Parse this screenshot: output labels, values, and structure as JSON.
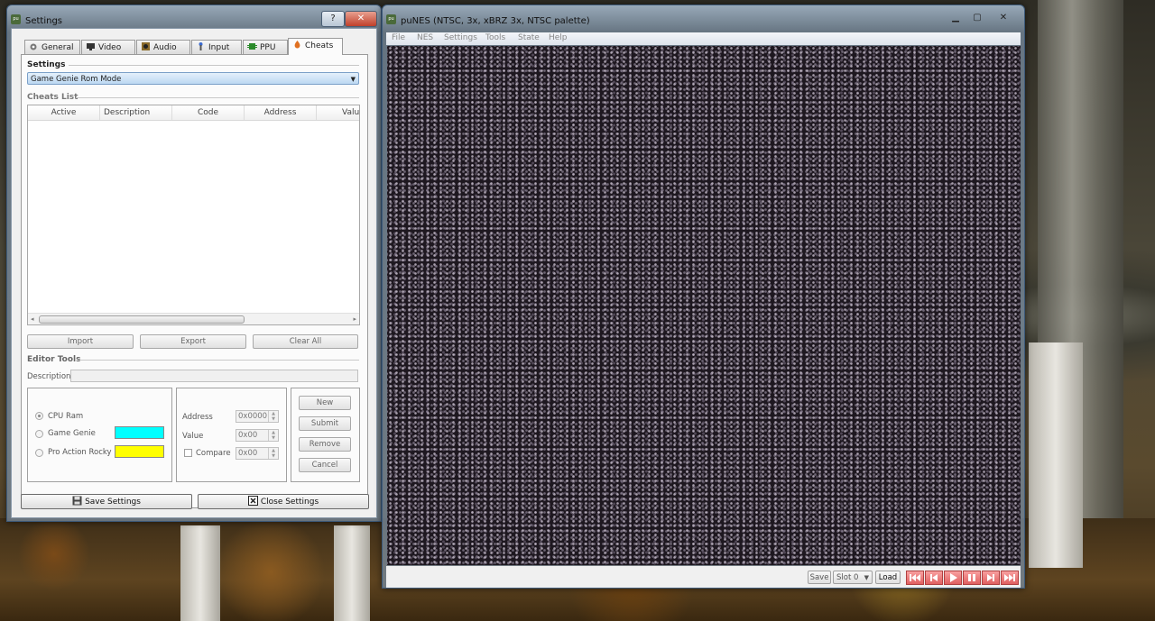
{
  "settings_window": {
    "title": "Settings",
    "help_btn": "?",
    "close_btn": "✕",
    "tabs": [
      {
        "label": "General",
        "icon": "gear-icon"
      },
      {
        "label": "Video",
        "icon": "monitor-icon"
      },
      {
        "label": "Audio",
        "icon": "speaker-icon"
      },
      {
        "label": "Input",
        "icon": "joystick-icon"
      },
      {
        "label": "PPU",
        "icon": "chip-icon"
      },
      {
        "label": "Cheats",
        "icon": "flame-icon"
      }
    ],
    "active_tab": "Cheats",
    "settings_section": "Settings",
    "mode_select": "Game Genie Rom Mode",
    "cheats_list_section": "Cheats List",
    "columns": [
      "Active",
      "Description",
      "Code",
      "Address",
      "Valu"
    ],
    "import_btn": "Import",
    "export_btn": "Export",
    "clear_all_btn": "Clear All",
    "editor_tools_section": "Editor Tools",
    "description_label": "Description",
    "radios": [
      {
        "label": "CPU Ram",
        "selected": true
      },
      {
        "label": "Game Genie",
        "selected": false,
        "swatch": "#00ffff"
      },
      {
        "label": "Pro Action Rocky",
        "selected": false,
        "swatch": "#ffff00"
      }
    ],
    "address_label": "Address",
    "address_value": "0x0000",
    "value_label": "Value",
    "value_value": "0x00",
    "compare_label": "Compare",
    "compare_value": "0x00",
    "new_btn": "New",
    "submit_btn": "Submit",
    "remove_btn": "Remove",
    "cancel_btn": "Cancel",
    "save_settings_btn": "Save Settings",
    "close_settings_btn": "Close Settings"
  },
  "punes_window": {
    "title": "puNES (NTSC, 3x, xBRZ 3x, NTSC palette)",
    "menu": [
      "File",
      "NES",
      "Settings",
      "Tools",
      "State",
      "Help"
    ],
    "save_btn": "Save",
    "slot_select": "Slot 0",
    "load_btn": "Load",
    "transport": [
      "rewind-fast-icon",
      "step-back-icon",
      "play-icon",
      "pause-icon",
      "step-forward-icon",
      "forward-fast-icon"
    ]
  }
}
